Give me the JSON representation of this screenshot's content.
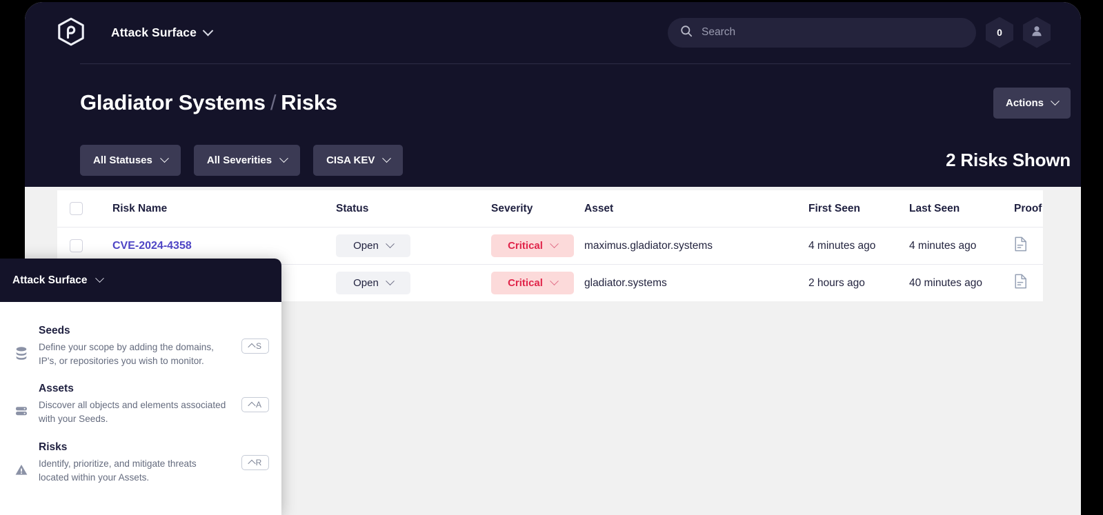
{
  "header": {
    "logo_icon": "hexagon-logo-icon",
    "brand_label": "Attack Surface",
    "brand_chevron_icon": "chevron-down-icon",
    "search": {
      "icon": "search-icon",
      "value": "",
      "placeholder": "Search"
    },
    "notification_count": "0",
    "avatar_icon": "user-avatar-icon"
  },
  "title": {
    "org": "Gladiator Systems",
    "separator": "/",
    "page": "Risks",
    "actions_label": "Actions",
    "actions_chevron_icon": "chevron-down-icon"
  },
  "filters": [
    {
      "label": "All Statuses",
      "icon": "chevron-down-icon"
    },
    {
      "label": "All Severities",
      "icon": "chevron-down-icon"
    },
    {
      "label": "CISA KEV",
      "icon": "chevron-down-icon"
    }
  ],
  "summary": {
    "risks_shown": "2 Risks Shown"
  },
  "table": {
    "columns": {
      "risk_name": "Risk Name",
      "status": "Status",
      "severity": "Severity",
      "asset": "Asset",
      "first_seen": "First Seen",
      "last_seen": "Last Seen",
      "proof": "Proof"
    },
    "select_all_icon": "checkbox-icon",
    "rows": [
      {
        "checkbox_icon": "checkbox-icon",
        "risk_name": "CVE-2024-4358",
        "status": "Open",
        "status_chevron_icon": "chevron-down-icon",
        "severity": "Critical",
        "severity_chevron_icon": "chevron-down-icon",
        "asset": "maximus.gladiator.systems",
        "first_seen": "4 minutes ago",
        "last_seen": "4 minutes ago",
        "proof_icon": "document-icon"
      },
      {
        "checkbox_icon": "checkbox-icon",
        "risk_name": "",
        "status": "Open",
        "status_chevron_icon": "chevron-down-icon",
        "severity": "Critical",
        "severity_chevron_icon": "chevron-down-icon",
        "asset": "gladiator.systems",
        "first_seen": "2 hours ago",
        "last_seen": "40 minutes ago",
        "proof_icon": "document-icon"
      }
    ]
  },
  "overlay_panel": {
    "header_label": "Attack Surface",
    "header_chevron_icon": "chevron-down-icon",
    "items": [
      {
        "icon": "database-stack-icon",
        "title": "Seeds",
        "description": "Define your scope by adding the domains, IP's, or repositories you wish to monitor.",
        "shortcut": "S"
      },
      {
        "icon": "server-rack-icon",
        "title": "Assets",
        "description": "Discover all objects and elements associated with your Seeds.",
        "shortcut": "A"
      },
      {
        "icon": "warning-triangle-icon",
        "title": "Risks",
        "description": "Identify, prioritize, and mitigate threats located within your Assets.",
        "shortcut": "R"
      }
    ]
  },
  "colors": {
    "dark_bg": "#141329",
    "page_bg": "#f1f1f1",
    "accent_link": "#4f46c6",
    "critical_text": "#e0254a",
    "critical_bg": "#fcdada",
    "control_bg": "#3b3a54"
  }
}
